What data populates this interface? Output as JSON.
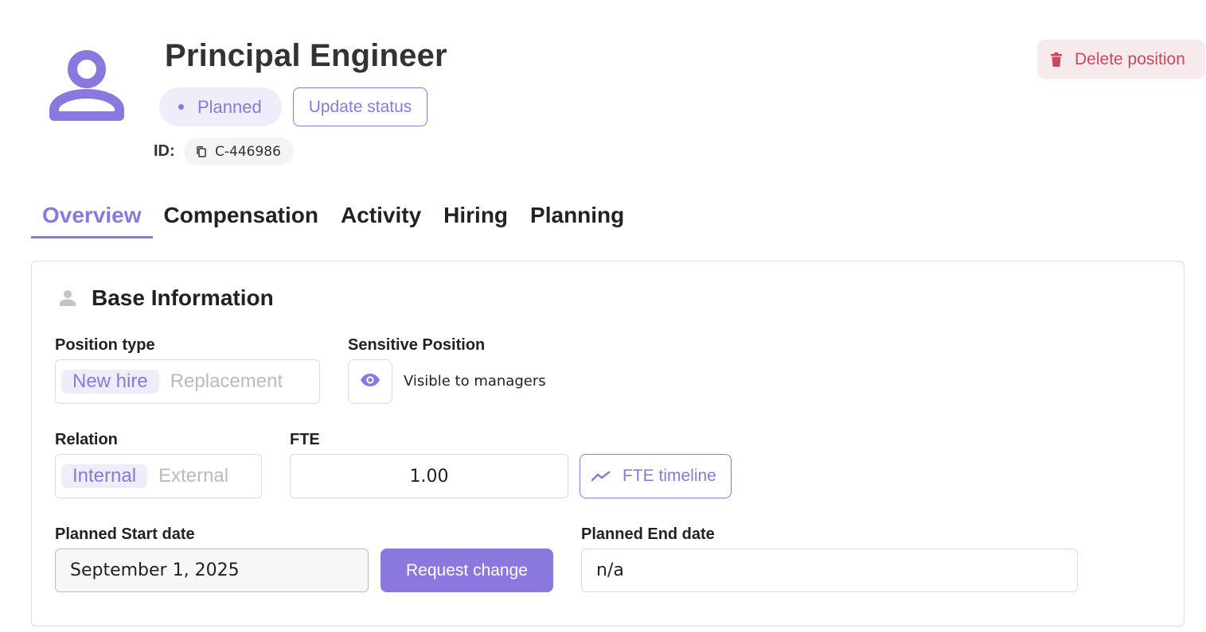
{
  "header": {
    "title": "Principal Engineer",
    "status": "Planned",
    "update_status_label": "Update status",
    "id_label": "ID:",
    "id_value": "C-446986",
    "delete_label": "Delete position"
  },
  "tabs": [
    {
      "label": "Overview",
      "active": true
    },
    {
      "label": "Compensation",
      "active": false
    },
    {
      "label": "Activity",
      "active": false
    },
    {
      "label": "Hiring",
      "active": false
    },
    {
      "label": "Planning",
      "active": false
    }
  ],
  "base_info": {
    "title": "Base Information",
    "position_type": {
      "label": "Position type",
      "options": [
        "New hire",
        "Replacement"
      ],
      "selected": "New hire"
    },
    "sensitive": {
      "label": "Sensitive Position",
      "text": "Visible to managers"
    },
    "relation": {
      "label": "Relation",
      "options": [
        "Internal",
        "External"
      ],
      "selected": "Internal"
    },
    "fte": {
      "label": "FTE",
      "value": "1.00",
      "timeline_label": "FTE timeline"
    },
    "start_date": {
      "label": "Planned Start date",
      "value": "September 1, 2025",
      "request_label": "Request change"
    },
    "end_date": {
      "label": "Planned End date",
      "value": "n/a"
    }
  },
  "colors": {
    "accent": "#8a78de",
    "accent_bg": "#efedfa",
    "danger": "#c9485e",
    "danger_bg": "#f7eaec"
  },
  "icons": [
    "person-avatar-icon",
    "copy-icon",
    "trash-icon",
    "person-icon",
    "eye-icon",
    "trending-up-icon"
  ]
}
